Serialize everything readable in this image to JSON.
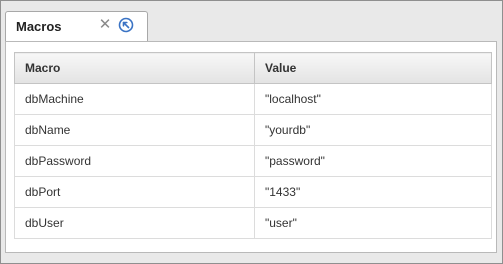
{
  "tab": {
    "label": "Macros",
    "close_icon": "close-icon",
    "nav_icon": "navigate-arrow-icon"
  },
  "table": {
    "columns": [
      "Macro",
      "Value"
    ],
    "rows": [
      {
        "macro": "dbMachine",
        "value": "\"localhost\""
      },
      {
        "macro": "dbName",
        "value": "\"yourdb\""
      },
      {
        "macro": "dbPassword",
        "value": "\"password\""
      },
      {
        "macro": "dbPort",
        "value": "\"1433\""
      },
      {
        "macro": "dbUser",
        "value": "\"user\""
      }
    ]
  },
  "colors": {
    "accent": "#3a73c4",
    "frame": "#e9e9e9"
  }
}
